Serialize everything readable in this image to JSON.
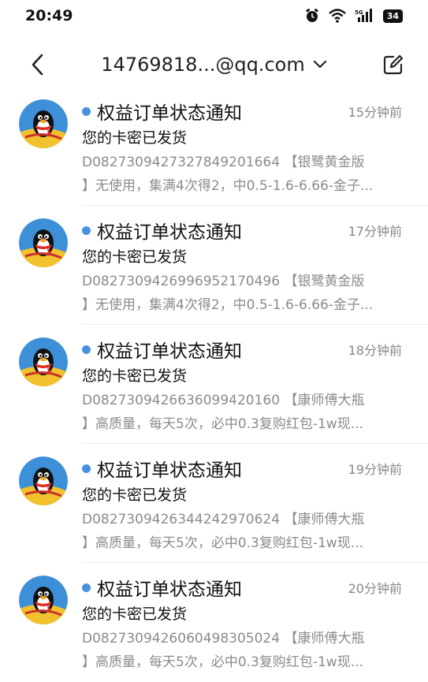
{
  "status_bar": {
    "time": "20:49",
    "battery": "34"
  },
  "header": {
    "account": "14769818...@qq.com"
  },
  "messages": [
    {
      "sender": "权益订单状态通知",
      "time": "15分钟前",
      "subject": "您的卡密已发货",
      "preview_line1": "D0827309427327849201664 【银鹭黄金版",
      "preview_line2": "】无使用，集满4次得2，中0.5-1.6-6.66-金子..."
    },
    {
      "sender": "权益订单状态通知",
      "time": "17分钟前",
      "subject": "您的卡密已发货",
      "preview_line1": "D0827309426996952170496 【银鹭黄金版",
      "preview_line2": "】无使用，集满4次得2，中0.5-1.6-6.66-金子..."
    },
    {
      "sender": "权益订单状态通知",
      "time": "18分钟前",
      "subject": "您的卡密已发货",
      "preview_line1": "D0827309426636099420160 【康师傅大瓶",
      "preview_line2": "】高质量，每天5次，必中0.3复购红包-1w现..."
    },
    {
      "sender": "权益订单状态通知",
      "time": "19分钟前",
      "subject": "您的卡密已发货",
      "preview_line1": "D0827309426344242970624 【康师傅大瓶",
      "preview_line2": "】高质量，每天5次，必中0.3复购红包-1w现..."
    },
    {
      "sender": "权益订单状态通知",
      "time": "20分钟前",
      "subject": "您的卡密已发货",
      "preview_line1": "D0827309426060498305024 【康师傅大瓶",
      "preview_line2": "】高质量，每天5次，必中0.3复购红包-1w现..."
    }
  ],
  "colors": {
    "unread_dot": "#4a90e2",
    "muted_text": "#8b8b8b",
    "avatar_bg": "#3d8fd8"
  }
}
